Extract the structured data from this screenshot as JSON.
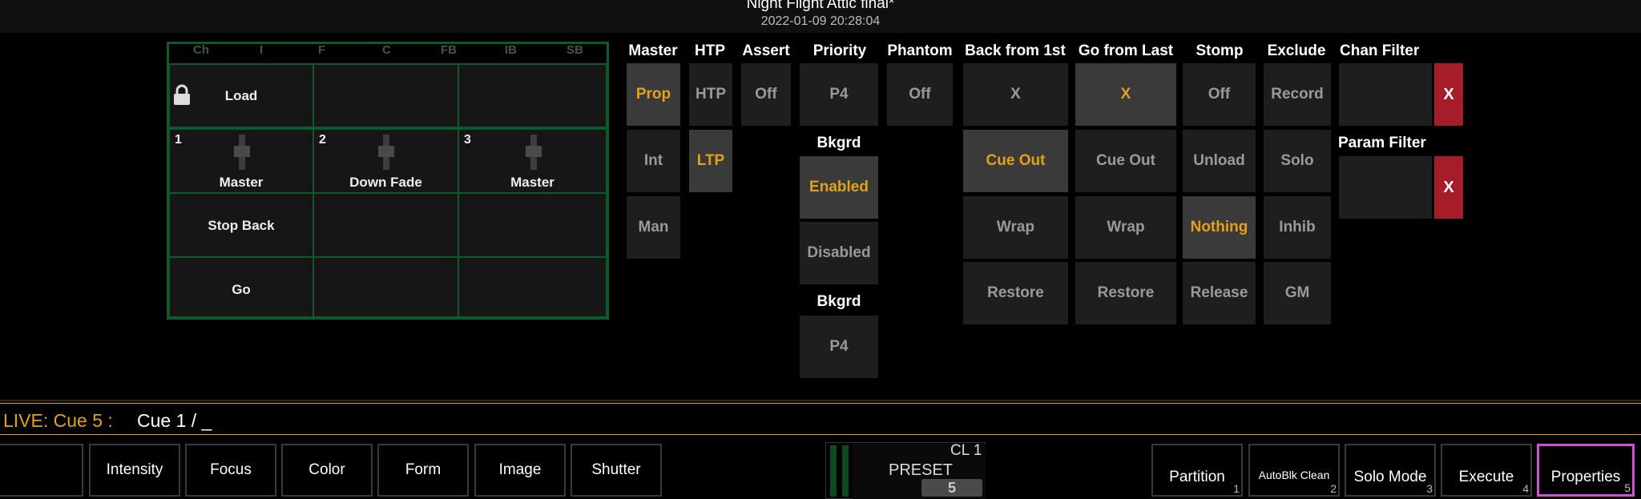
{
  "header": {
    "title": "Night Flight Attic final*",
    "subtitle": "2022-01-09 20:28:04"
  },
  "fader_grid": {
    "column_headers": [
      "Ch",
      "I",
      "F",
      "C",
      "FB",
      "IB",
      "SB"
    ],
    "rows": [
      [
        {
          "label": "Load",
          "icon": "lock-icon"
        },
        {
          "label": ""
        },
        {
          "label": ""
        }
      ],
      [
        {
          "num": "1",
          "label": "Master"
        },
        {
          "num": "2",
          "label": "Down Fade"
        },
        {
          "num": "3",
          "label": "Master"
        }
      ],
      [
        {
          "label": "Stop Back"
        },
        {
          "label": ""
        },
        {
          "label": ""
        }
      ],
      [
        {
          "label": "Go"
        },
        {
          "label": ""
        },
        {
          "label": ""
        }
      ]
    ]
  },
  "columns": {
    "master": {
      "title": "Master",
      "options": [
        "Prop",
        "Int",
        "Man"
      ],
      "selected": "Prop"
    },
    "htp": {
      "title": "HTP",
      "options": [
        "HTP",
        "LTP"
      ],
      "selected": "LTP"
    },
    "assert": {
      "title": "Assert",
      "options": [
        "Off"
      ]
    },
    "priority": {
      "title": "Priority",
      "value": "P4",
      "bkgrd_title": "Bkgrd",
      "bkgrd_options": [
        "Enabled",
        "Disabled"
      ],
      "bkgrd_selected": "Enabled",
      "bkgrd2_title": "Bkgrd",
      "bkgrd2_value": "P4"
    },
    "phantom": {
      "title": "Phantom",
      "options": [
        "Off"
      ]
    },
    "back_from_first": {
      "title": "Back from 1st",
      "options": [
        "X",
        "Cue Out",
        "Wrap",
        "Restore"
      ],
      "selected": "Cue Out"
    },
    "go_from_last": {
      "title": "Go from Last",
      "options": [
        "X",
        "Cue Out",
        "Wrap",
        "Restore"
      ],
      "selected": "X"
    },
    "stomp": {
      "title": "Stomp",
      "options": [
        "Off",
        "Unload",
        "Nothing",
        "Release"
      ],
      "selected": "Nothing"
    },
    "exclude": {
      "title": "Exclude",
      "options": [
        "Record",
        "Solo",
        "Inhib",
        "GM"
      ]
    },
    "chan_filter": {
      "title": "Chan Filter",
      "clear_label": "X"
    },
    "param_filter": {
      "title": "Param Filter",
      "clear_label": "X"
    }
  },
  "command_line": {
    "prefix": "LIVE: Cue  5 :",
    "text": "Cue 1 / _"
  },
  "bottom_left_buttons": [
    "",
    "Intensity",
    "Focus",
    "Color",
    "Form",
    "Image",
    "Shutter"
  ],
  "preset": {
    "label": "PRESET",
    "cl": "CL 1",
    "number": "5"
  },
  "softkeys": [
    {
      "label": "Partition",
      "num": "1"
    },
    {
      "label": "AutoBlk Clean",
      "num": "2"
    },
    {
      "label": "Solo Mode",
      "num": "3"
    },
    {
      "label": "Execute",
      "num": "4"
    },
    {
      "label": "Properties",
      "num": "5",
      "highlighted": true
    }
  ],
  "colors": {
    "accent": "#e3a11a",
    "grid_border": "#0f5a2a",
    "clear_red": "#a61d2a",
    "highlight": "#d14fd1"
  }
}
